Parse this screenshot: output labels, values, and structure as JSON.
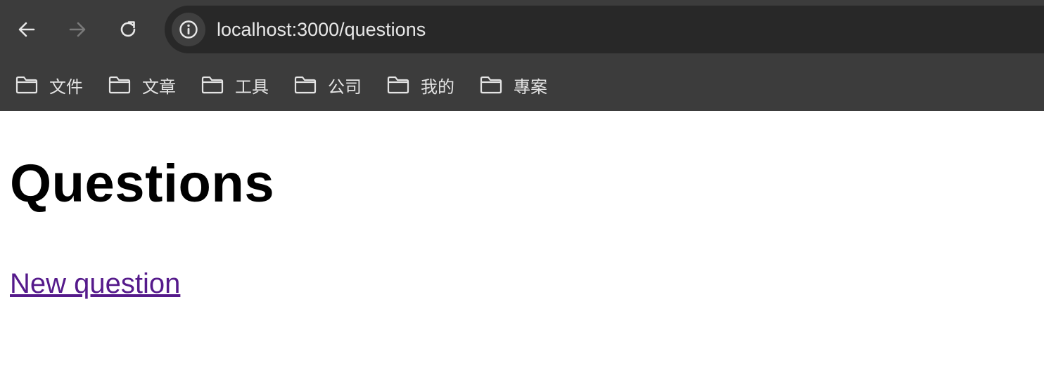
{
  "browser": {
    "url": "localhost:3000/questions",
    "nav": {
      "back_icon": "arrow-left-icon",
      "forward_icon": "arrow-right-icon",
      "reload_icon": "reload-icon",
      "site_info_icon": "info-icon"
    },
    "bookmarks": [
      {
        "label": "文件",
        "icon": "folder-icon"
      },
      {
        "label": "文章",
        "icon": "folder-icon"
      },
      {
        "label": "工具",
        "icon": "folder-icon"
      },
      {
        "label": "公司",
        "icon": "folder-icon"
      },
      {
        "label": "我的",
        "icon": "folder-icon"
      },
      {
        "label": "專案",
        "icon": "folder-icon"
      }
    ],
    "colors": {
      "chrome_bg": "#3c3c3c",
      "address_bg": "#282828",
      "text": "#e8e8e8"
    }
  },
  "page": {
    "title": "Questions",
    "new_link": "New question",
    "colors": {
      "link": "#551a8b",
      "title": "#000000"
    }
  }
}
